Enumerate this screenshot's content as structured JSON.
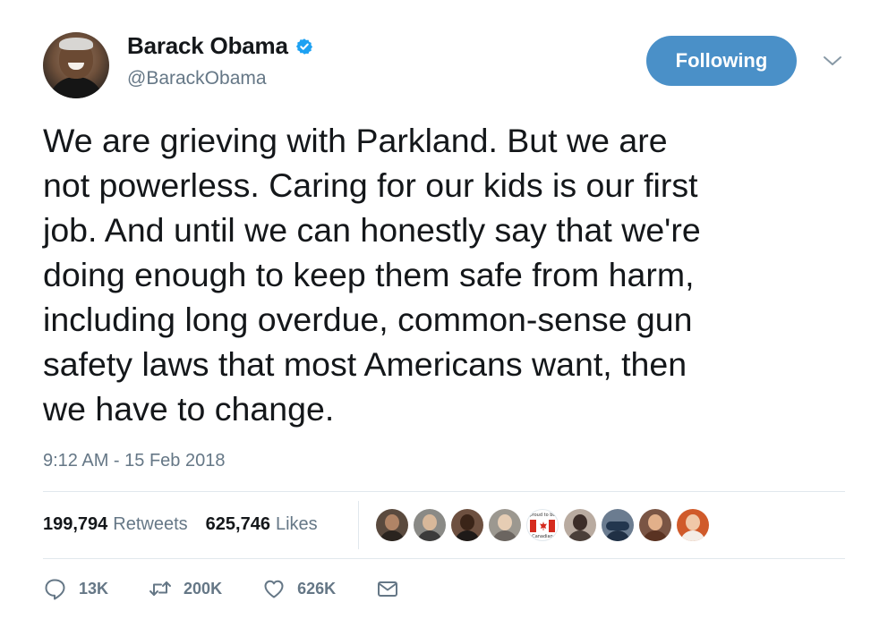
{
  "author": {
    "display_name": "Barack Obama",
    "handle": "@BarackObama",
    "verified": true,
    "verified_color": "#1da1f2"
  },
  "follow_button": {
    "label": "Following",
    "color": "#4a90c8"
  },
  "tweet": {
    "lines": [
      "We are grieving with Parkland. But we are",
      "not powerless. Caring for our kids is our first",
      "job. And until we can honestly say that we're",
      "doing enough to keep them safe from harm,",
      "including long overdue, common-sense gun",
      "safety laws that most Americans want, then",
      "we have to change."
    ],
    "timestamp": "9:12 AM - 15 Feb 2018"
  },
  "stats": {
    "retweets_count": "199,794",
    "retweets_label": "Retweets",
    "likes_count": "625,746",
    "likes_label": "Likes"
  },
  "likers": {
    "count": 9,
    "flag_caption_top": "proud to be",
    "flag_caption_bottom": "Canadian"
  },
  "actions": {
    "reply_count": "13K",
    "retweet_count": "200K",
    "like_count": "626K"
  },
  "colors": {
    "text_primary": "#14171a",
    "text_secondary": "#657786",
    "divider": "#e1e8ed"
  },
  "icons": {
    "verified": "verified-badge-icon",
    "caret": "chevron-down-icon",
    "reply": "reply-icon",
    "retweet": "retweet-icon",
    "like": "heart-icon",
    "dm": "envelope-icon"
  }
}
